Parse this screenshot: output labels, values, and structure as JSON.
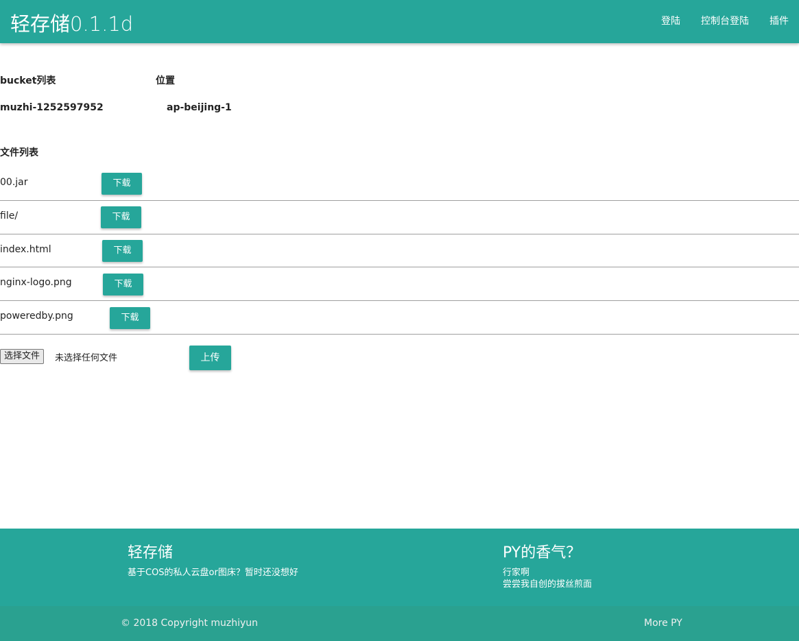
{
  "navbar": {
    "brand": "轻存储0.1.1d",
    "links": [
      "登陆",
      "控制台登陆",
      "插件"
    ]
  },
  "bucket": {
    "header_bucket": "bucket列表",
    "header_location": "位置",
    "name": "muzhi-1252597952",
    "location": "ap-beijing-1"
  },
  "files": {
    "title": "文件列表",
    "download_label": "下载",
    "items": [
      "00.jar",
      "file/",
      "index.html",
      "nginx-logo.png",
      "poweredby.png"
    ]
  },
  "upload": {
    "choose_label": "选择文件",
    "no_file_text": "未选择任何文件",
    "upload_label": "上传"
  },
  "footer": {
    "left_title": "轻存储",
    "left_text": "基于COS的私人云盘or图床？暂时还没想好",
    "right_title": "PY的香气？",
    "right_line1": "行家啊",
    "right_line2": "尝尝我自创的拔丝煎面",
    "copyright": "© 2018 Copyright muzhiyun",
    "more": "More PY"
  },
  "colors": {
    "accent": "#26a69a",
    "footer_bottom": "#2aa190"
  }
}
